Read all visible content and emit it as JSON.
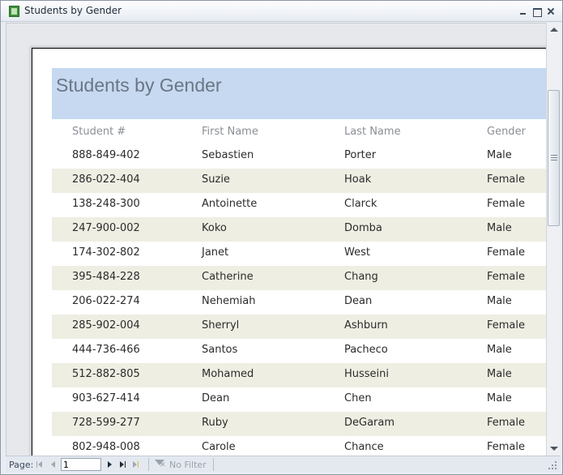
{
  "window": {
    "title": "Students by Gender"
  },
  "report": {
    "title": "Students by Gender",
    "columns": [
      "Student #",
      "First Name",
      "Last Name",
      "Gender"
    ],
    "rows": [
      [
        "888-849-402",
        "Sebastien",
        "Porter",
        "Male"
      ],
      [
        "286-022-404",
        "Suzie",
        "Hoak",
        "Female"
      ],
      [
        "138-248-300",
        "Antoinette",
        "Clarck",
        "Female"
      ],
      [
        "247-900-002",
        "Koko",
        "Domba",
        "Male"
      ],
      [
        "174-302-802",
        "Janet",
        "West",
        "Female"
      ],
      [
        "395-484-228",
        "Catherine",
        "Chang",
        "Female"
      ],
      [
        "206-022-274",
        "Nehemiah",
        "Dean",
        "Male"
      ],
      [
        "285-902-004",
        "Sherryl",
        "Ashburn",
        "Female"
      ],
      [
        "444-736-466",
        "Santos",
        "Pacheco",
        "Male"
      ],
      [
        "512-882-805",
        "Mohamed",
        "Husseini",
        "Male"
      ],
      [
        "903-627-414",
        "Dean",
        "Chen",
        "Male"
      ],
      [
        "728-599-277",
        "Ruby",
        "DeGaram",
        "Female"
      ],
      [
        "802-948-008",
        "Carole",
        "Chance",
        "Female"
      ]
    ]
  },
  "navigation": {
    "page_label": "Page:",
    "page_value": "1",
    "filter_label": "No Filter"
  },
  "colors": {
    "header_band": "#c6d9f1",
    "alt_row": "#efeee3",
    "title_text": "#6b7684"
  },
  "icons": {
    "app": "access-report-icon",
    "minimize": "minimize-icon",
    "restore": "restore-icon",
    "close": "close-icon",
    "filter": "filter-off-icon"
  }
}
